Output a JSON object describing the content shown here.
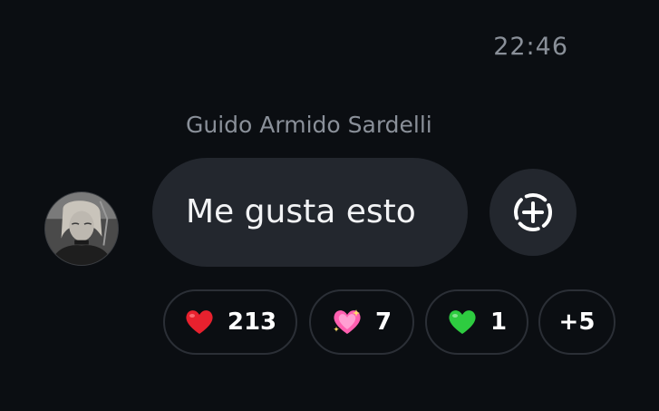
{
  "message": {
    "timestamp": "22:46",
    "sender_name": "Guido Armido Sardelli",
    "text": "Me gusta esto"
  },
  "add_reaction": {
    "icon": "add-reaction-icon"
  },
  "reactions": [
    {
      "icon": "red-heart-icon",
      "color": "#e8212e",
      "count": "213"
    },
    {
      "icon": "sparkling-pink-heart-icon",
      "color": "#ff5fb0",
      "count": "7"
    },
    {
      "icon": "green-heart-icon",
      "color": "#2ecc40",
      "count": "1"
    }
  ],
  "more_reactions": {
    "label": "+5"
  },
  "colors": {
    "background": "#0b0e12",
    "bubble": "#23272e",
    "muted_text": "#8a9099",
    "chip_border": "#2b2f36"
  }
}
